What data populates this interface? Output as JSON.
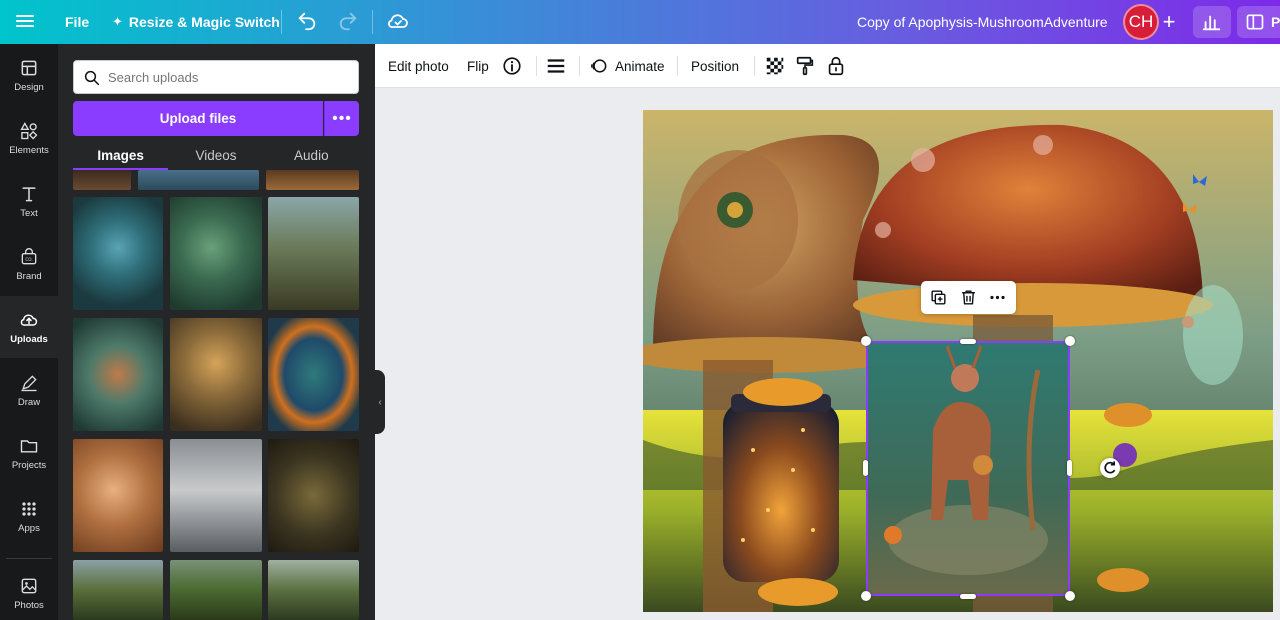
{
  "topbar": {
    "file_label": "File",
    "resize_label": "Resize & Magic Switch",
    "doc_title": "Copy of Apophysis-MushroomAdventure",
    "avatar_initials": "CH",
    "present_label": "P"
  },
  "rail": {
    "items": [
      {
        "label": "Design",
        "icon": "design-icon"
      },
      {
        "label": "Elements",
        "icon": "elements-icon"
      },
      {
        "label": "Text",
        "icon": "text-icon"
      },
      {
        "label": "Brand",
        "icon": "brand-icon"
      },
      {
        "label": "Uploads",
        "icon": "uploads-icon",
        "active": true
      },
      {
        "label": "Draw",
        "icon": "draw-icon"
      },
      {
        "label": "Projects",
        "icon": "projects-icon"
      },
      {
        "label": "Apps",
        "icon": "apps-icon"
      },
      {
        "label": "Photos",
        "icon": "photos-icon"
      }
    ]
  },
  "panel": {
    "search_placeholder": "Search uploads",
    "upload_label": "Upload files",
    "tabs": [
      {
        "label": "Images",
        "active": true
      },
      {
        "label": "Videos"
      },
      {
        "label": "Audio"
      }
    ]
  },
  "context_toolbar": {
    "edit_photo": "Edit photo",
    "flip": "Flip",
    "animate": "Animate",
    "position": "Position"
  },
  "colors": {
    "accent": "#8b3dff",
    "rail_bg": "#18191b",
    "panel_bg": "#252627",
    "avatar_bg": "#d81d38"
  }
}
